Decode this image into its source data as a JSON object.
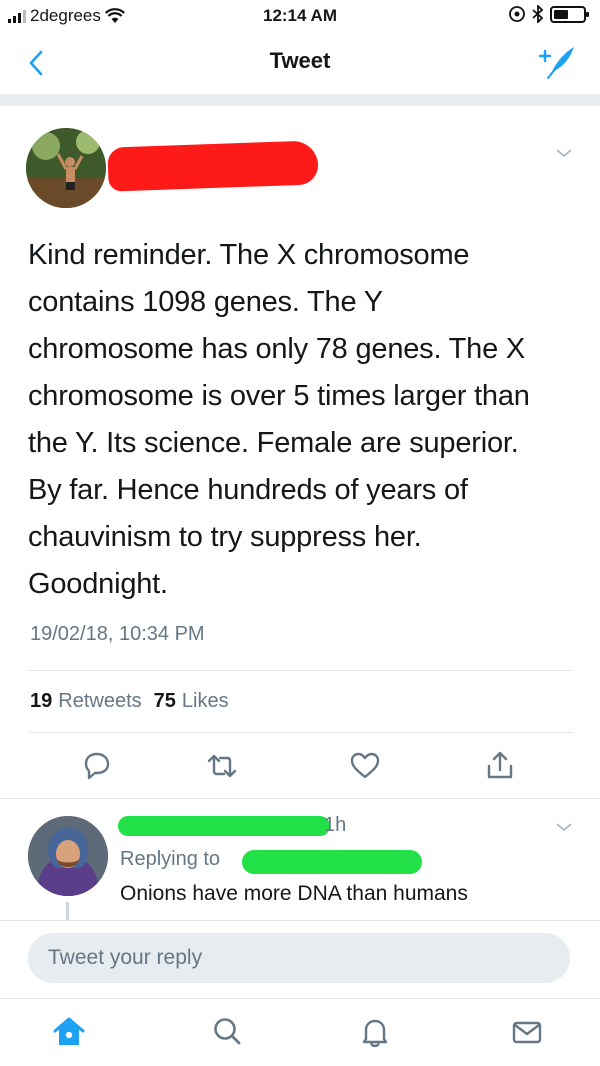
{
  "status_bar": {
    "carrier": "2degrees",
    "time": "12:14 AM"
  },
  "nav": {
    "title": "Tweet",
    "back_icon": "chevron-left-icon",
    "compose_icon": "compose-tweet-icon"
  },
  "colors": {
    "accent": "#1da1f2",
    "text": "#14171a",
    "muted": "#657786",
    "redaction_red": "#ff1a1a",
    "redaction_green": "#22e048"
  },
  "tweet": {
    "text_lines": [
      "Kind reminder. The X chromosome",
      "contains 1098 genes. The Y",
      "chromosome has only 78 genes. The X",
      "chromosome is over 5 times larger than",
      "the Y. Its science. Female are superior.",
      "By far. Hence hundreds of years of",
      "chauvinism to try suppress her.",
      "Goodnight."
    ],
    "timestamp": "19/02/18, 10:34 PM",
    "retweets_count": "19",
    "retweets_label": "Retweets",
    "likes_count": "75",
    "likes_label": "Likes"
  },
  "reply": {
    "time": "1h",
    "replying_to": "Replying to",
    "text": "Onions have more DNA than humans"
  },
  "compose": {
    "placeholder": "Tweet your reply"
  },
  "tab_bar": {
    "items": [
      "home-icon",
      "search-icon",
      "notifications-icon",
      "messages-icon"
    ]
  }
}
